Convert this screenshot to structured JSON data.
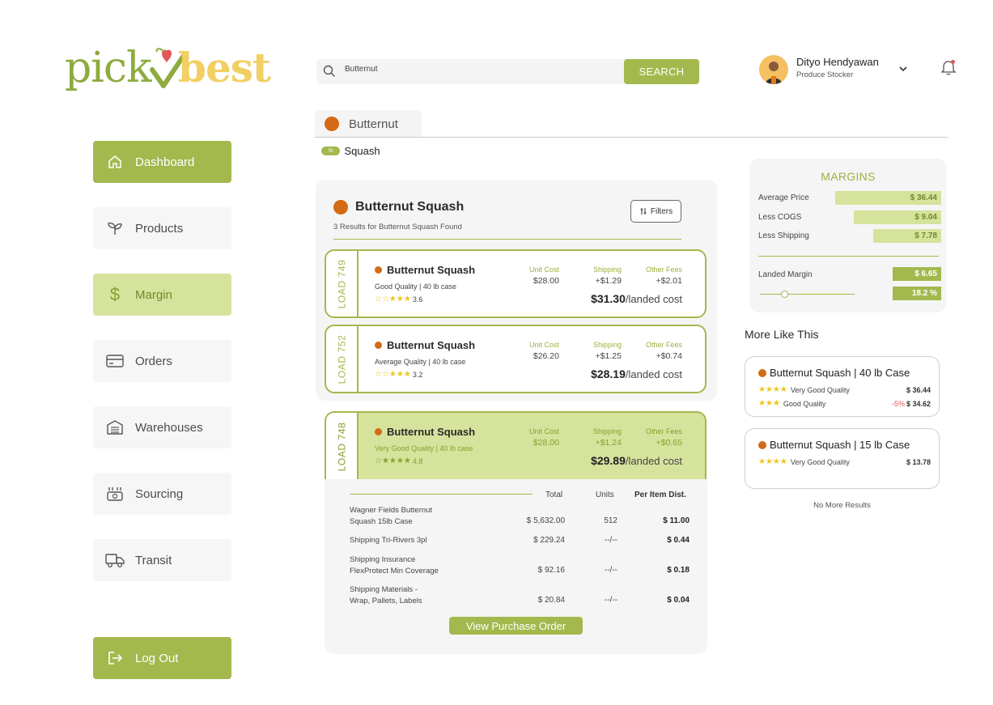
{
  "brand": {
    "part1": "pick",
    "part2": "best"
  },
  "sidebar": {
    "items": [
      {
        "label": "Dashboard"
      },
      {
        "label": "Products"
      },
      {
        "label": "Margin"
      },
      {
        "label": "Orders"
      },
      {
        "label": "Warehouses"
      },
      {
        "label": "Sourcing"
      },
      {
        "label": "Transit"
      }
    ],
    "logout_label": "Log Out"
  },
  "search": {
    "value": "Butternut",
    "button_label": "SEARCH"
  },
  "user": {
    "name": "Dityo Hendyawan",
    "role": "Produce Stocker"
  },
  "breadcrumb": {
    "label": "Butternut",
    "tag_pill": "Is",
    "tag_label": "Squash"
  },
  "results": {
    "title": "Butternut Squash",
    "subtitle": "3 Results for Butternut Squash Found",
    "filters_label": "Filters",
    "column_headers": {
      "unit_cost": "Unit Cost",
      "shipping": "Shipping",
      "other_fees": "Other Fees",
      "landed_suffix": "/landed cost"
    },
    "loads": [
      {
        "id": "LOAD 749",
        "name": "Butternut Squash",
        "quality": "Good Quality",
        "case": "| 40 lb case",
        "stars": "☆☆★★★",
        "rating": "3.6",
        "unit_cost": "$28.00",
        "shipping": "+$1.29",
        "other_fees": "+$2.01",
        "landed": "$31.30"
      },
      {
        "id": "LOAD 752",
        "name": "Butternut Squash",
        "quality": "Average Quality",
        "case": "| 40 lb case",
        "stars": "☆☆★★★",
        "rating": "3.2",
        "unit_cost": "$26.20",
        "shipping": "+$1.25",
        "other_fees": "+$0.74",
        "landed": "$28.19"
      },
      {
        "id": "LOAD 748",
        "name": "Butternut Squash",
        "quality": "Very Good Quality",
        "case": "| 40 lb case",
        "stars": "☆★★★★",
        "rating": "4.8",
        "unit_cost": "$28.00",
        "shipping": "+$1.24",
        "other_fees": "+$0.65",
        "landed": "$29.89"
      }
    ]
  },
  "breakdown": {
    "headers": {
      "total": "Total",
      "units": "Units",
      "per_item": "Per Item Dist."
    },
    "rows": [
      {
        "label1": "Wagner Fields Butternut",
        "label2": "Squash 15lb Case",
        "total": "$ 5,632.00",
        "units": "512",
        "per_item": "$ 11.00"
      },
      {
        "label1": "Shipping Tri-Rivers 3pl",
        "label2": "",
        "total": "$ 229.24",
        "units": "--/--",
        "per_item": "$ 0.44"
      },
      {
        "label1": "Shipping Insurance",
        "label2": "FlexProtect Min Coverage",
        "total": "$ 92.16",
        "units": "--/--",
        "per_item": "$ 0.18"
      },
      {
        "label1": "Shipping Materials -",
        "label2": "Wrap, Pallets, Labels",
        "total": "$ 20.84",
        "units": "--/--",
        "per_item": "$ 0.04"
      }
    ],
    "button_label": "View Purchase Order"
  },
  "margins": {
    "title": "MARGINS",
    "rows": [
      {
        "label": "Average Price",
        "value": "$ 36.44"
      },
      {
        "label": "Less COGS",
        "value": "$ 9.04"
      },
      {
        "label": "Less Shipping",
        "value": "$ 7.78"
      }
    ],
    "landed_label": "Landed Margin",
    "landed_value": "$ 6.65",
    "landed_percent": "18.2 %",
    "accent": "#a3b94e",
    "light": "#d6e39c"
  },
  "more_like_this": {
    "title": "More Like This",
    "cards": [
      {
        "title": "Butternut Squash | 40 lb Case",
        "rows": [
          {
            "stars": "★★★★",
            "quality": "Very Good Quality",
            "discount": "",
            "price": "$ 36.44"
          },
          {
            "stars": "★★★",
            "quality": "Good Quality",
            "discount": "-5%",
            "price": "$ 34.62"
          }
        ]
      },
      {
        "title": "Butternut Squash | 15 lb Case",
        "rows": [
          {
            "stars": "★★★★",
            "quality": "Very Good Quality",
            "discount": "",
            "price": "$ 13.78"
          }
        ]
      }
    ],
    "no_more": "No More Results"
  }
}
